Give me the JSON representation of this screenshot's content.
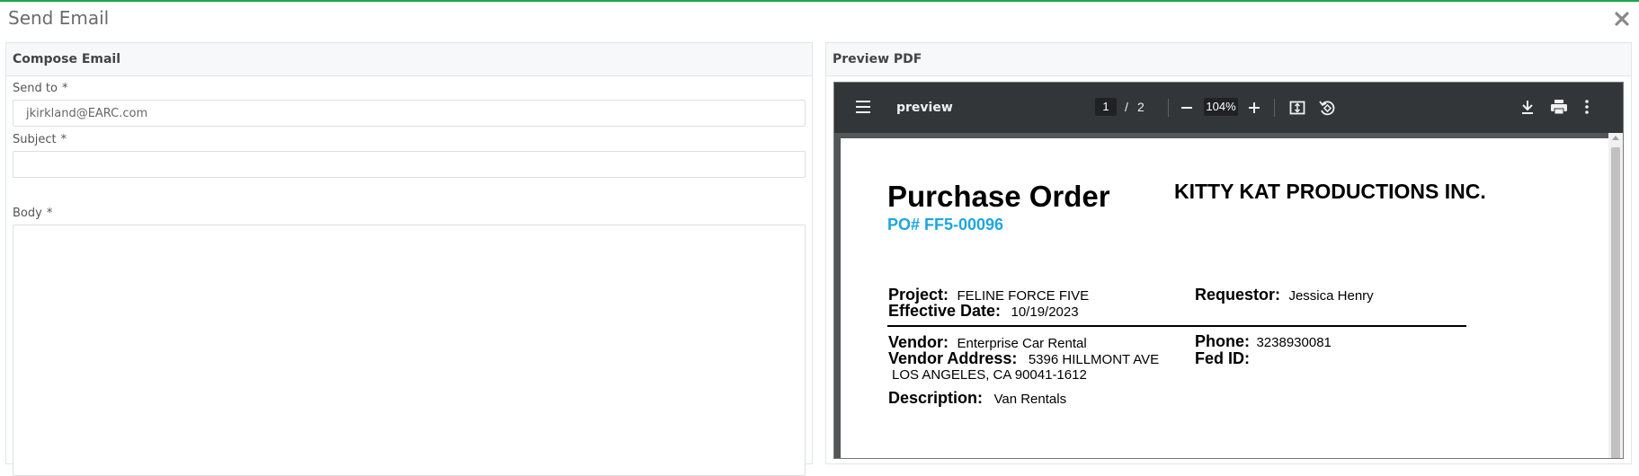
{
  "dialog": {
    "title": "Send Email"
  },
  "compose": {
    "header": "Compose Email",
    "send_to": {
      "label": "Send to",
      "required": "*",
      "value": "jkirkland@EARC.com"
    },
    "subject": {
      "label": "Subject",
      "required": "*",
      "value": ""
    },
    "body": {
      "label": "Body",
      "required": "*",
      "value": ""
    }
  },
  "preview": {
    "header": "Preview PDF",
    "toolbar": {
      "doc_title": "preview",
      "page_current": "1",
      "page_separator": "/",
      "page_total": "2",
      "zoom": "104%",
      "icons": [
        "menu-icon",
        "zoom-out-icon",
        "zoom-in-icon",
        "fit-page-icon",
        "rotate-icon",
        "download-icon",
        "print-icon",
        "more-vert-icon"
      ]
    },
    "pdf": {
      "title": "Purchase Order",
      "company": "KITTY KAT PRODUCTIONS INC.",
      "po_number": "PO# FF5-00096",
      "project_label": "Project:",
      "project_value": "FELINE FORCE FIVE",
      "effective_date_label": "Effective Date:",
      "effective_date_value": "10/19/2023",
      "requestor_label": "Requestor:",
      "requestor_value": "Jessica Henry",
      "vendor_label": "Vendor:",
      "vendor_value": "Enterprise Car Rental",
      "vendor_address_label": "Vendor Address:",
      "vendor_address_line1": "5396 HILLMONT AVE",
      "vendor_address_line2": "LOS ANGELES, CA 90041-1612",
      "phone_label": "Phone:",
      "phone_value": "3238930081",
      "fed_id_label": "Fed ID:",
      "fed_id_value": "",
      "description_label": "Description:",
      "description_value": "Van Rentals",
      "accent_color": "#1ea6e0"
    }
  }
}
